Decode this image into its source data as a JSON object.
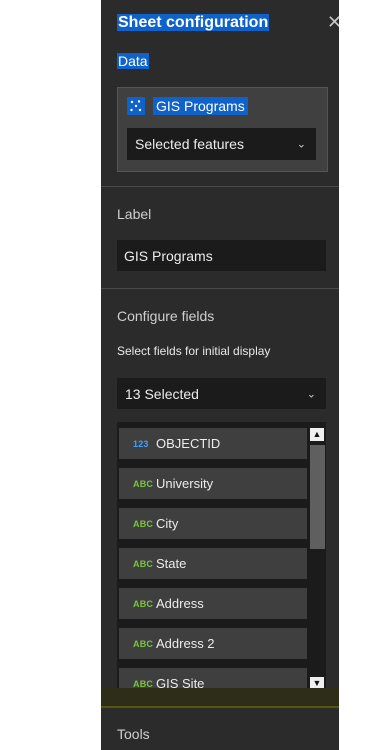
{
  "panel": {
    "title": "Sheet configuration",
    "close_icon": "close-icon"
  },
  "data_section": {
    "heading": "Data",
    "layer_name": "GIS Programs",
    "layer_icon": "point-layer-icon",
    "selection_mode": "Selected features"
  },
  "label_section": {
    "heading": "Label",
    "value": "GIS Programs"
  },
  "fields_section": {
    "heading": "Configure fields",
    "hint": "Select fields for initial display",
    "selected_summary": "13 Selected",
    "fields": [
      {
        "type": "123",
        "name": "OBJECTID"
      },
      {
        "type": "ABC",
        "name": "University"
      },
      {
        "type": "ABC",
        "name": "City"
      },
      {
        "type": "ABC",
        "name": "State"
      },
      {
        "type": "ABC",
        "name": "Address"
      },
      {
        "type": "ABC",
        "name": "Address 2"
      },
      {
        "type": "ABC",
        "name": "GIS Site"
      }
    ]
  },
  "tools_section": {
    "heading": "Tools"
  },
  "colors": {
    "panel_bg": "#2b2b2b",
    "accent_blue": "#0f62c9",
    "numeric_type": "#3da2ff",
    "string_type": "#7bc43d"
  }
}
